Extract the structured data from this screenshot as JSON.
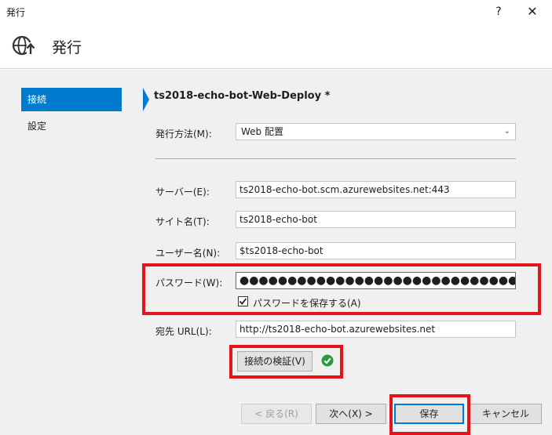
{
  "window": {
    "title": "発行",
    "help_label": "?",
    "close_label": "✕"
  },
  "header": {
    "title": "発行",
    "icon": "globe-publish-icon"
  },
  "sidebar": {
    "items": [
      {
        "label": "接続",
        "active": true
      },
      {
        "label": "設定",
        "active": false
      }
    ]
  },
  "profile": {
    "name": "ts2018-echo-bot-Web-Deploy *"
  },
  "form": {
    "method": {
      "label": "発行方法(M):",
      "value": "Web 配置"
    },
    "server": {
      "label": "サーバー(E):",
      "value": "ts2018-echo-bot.scm.azurewebsites.net:443"
    },
    "site": {
      "label": "サイト名(T):",
      "value": "ts2018-echo-bot"
    },
    "user": {
      "label": "ユーザー名(N):",
      "value": "$ts2018-echo-bot"
    },
    "password": {
      "label": "パスワード(W):",
      "value": "●●●●●●●●●●●●●●●●●●●●●●●●●●●●●●●●●●●●●●●"
    },
    "save_password": {
      "label": "パスワードを保存する(A)",
      "checked": true
    },
    "destination": {
      "label": "宛先 URL(L):",
      "value": "http://ts2018-echo-bot.azurewebsites.net"
    },
    "validate_button": "接続の検証(V)",
    "validation_status": "success-check-icon"
  },
  "footer": {
    "back": "< 戻る(R)",
    "next": "次へ(X) >",
    "save": "保存",
    "cancel": "キャンセル"
  },
  "colors": {
    "accent": "#007acc",
    "highlight": "#e5141a",
    "success": "#2b9a3f"
  }
}
